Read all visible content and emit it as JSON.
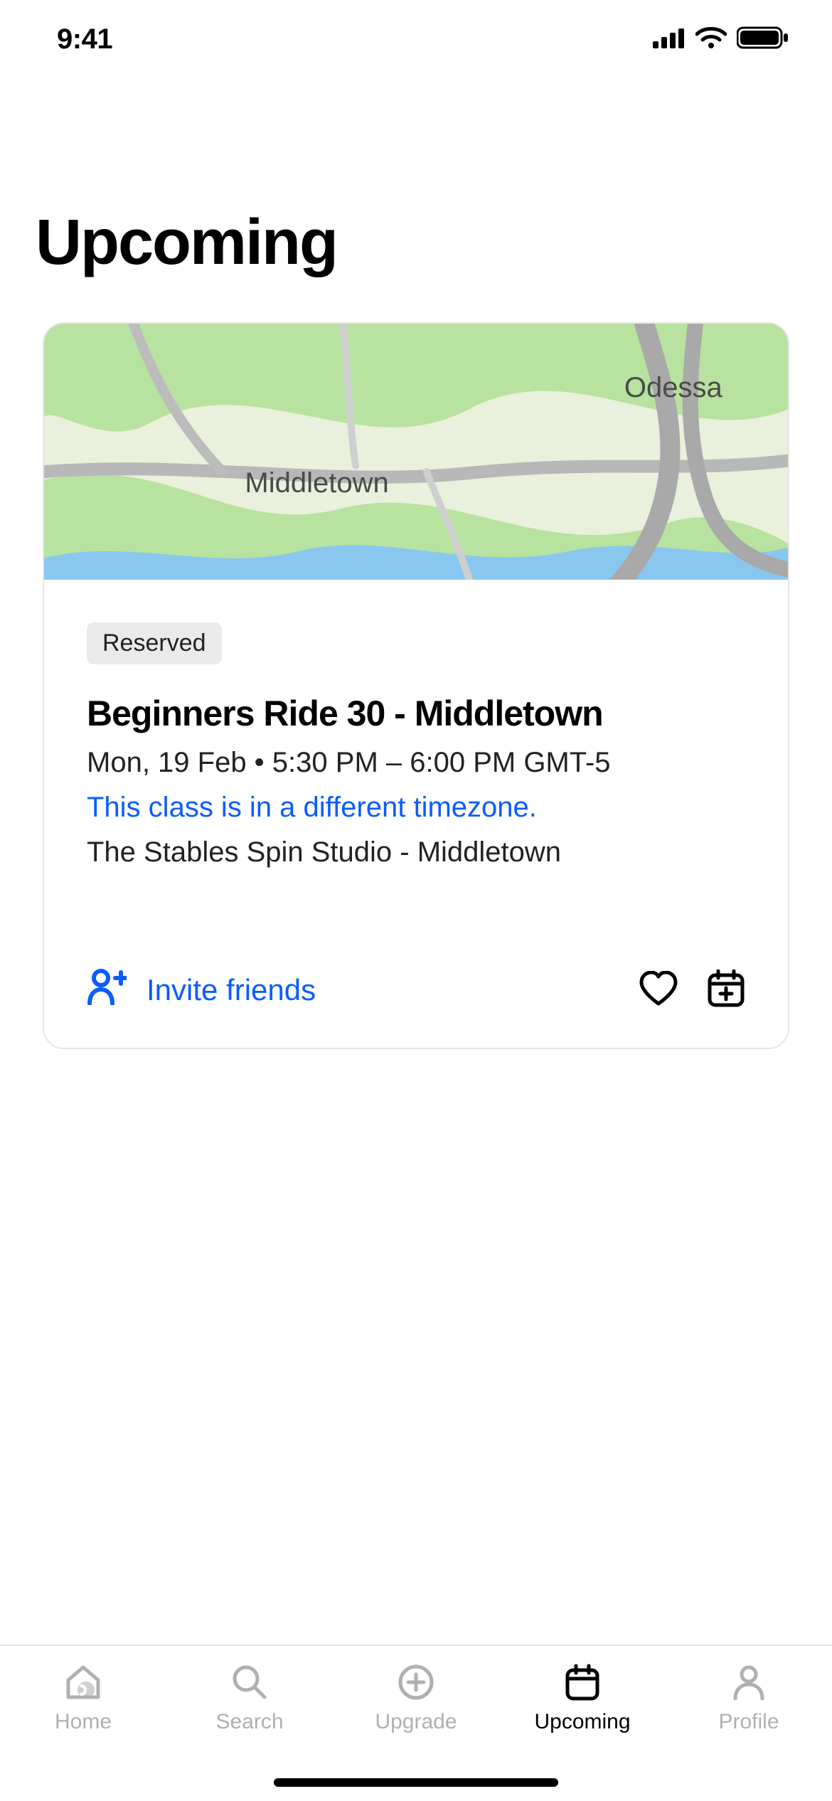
{
  "status": {
    "time": "9:41"
  },
  "header": {
    "title": "Upcoming"
  },
  "card": {
    "map": {
      "cityMain": "Middletown",
      "citySecondary": "Odessa"
    },
    "badge": "Reserved",
    "title": "Beginners Ride 30 - Middletown",
    "datetime": "Mon, 19 Feb • 5:30 PM – 6:00 PM GMT-5",
    "timezoneNote": "This class is in a different timezone.",
    "venue": "The Stables Spin Studio - Middletown",
    "inviteLabel": "Invite friends"
  },
  "tabs": {
    "home": "Home",
    "search": "Search",
    "upgrade": "Upgrade",
    "upcoming": "Upcoming",
    "profile": "Profile"
  }
}
